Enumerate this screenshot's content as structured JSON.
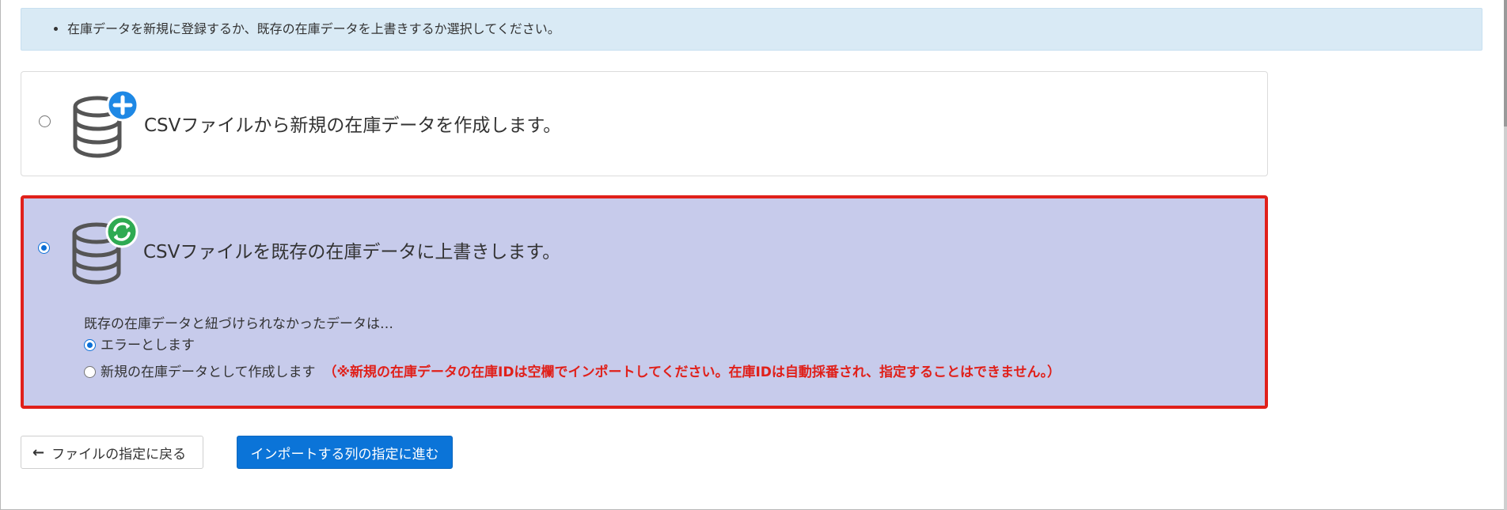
{
  "info": {
    "message": "在庫データを新規に登録するか、既存の在庫データを上書きするか選択してください。"
  },
  "options": [
    {
      "title": "CSVファイルから新規の在庫データを作成します。",
      "icon": "database-plus-icon",
      "selected": false
    },
    {
      "title": "CSVファイルを既存の在庫データに上書きします。",
      "icon": "database-sync-icon",
      "selected": true,
      "sub_question": "既存の在庫データと紐づけられなかったデータは…",
      "sub_options": [
        {
          "label": "エラーとします",
          "selected": true
        },
        {
          "label": "新規の在庫データとして作成します",
          "note": "（※新規の在庫データの在庫IDは空欄でインポートしてください。在庫IDは自動採番され、指定することはできません。）",
          "selected": false
        }
      ]
    }
  ],
  "buttons": {
    "back": "ファイルの指定に戻る",
    "next": "インポートする列の指定に進む"
  },
  "colors": {
    "accent": "#0b74d8",
    "highlight_border": "#e0201a",
    "highlight_bg": "#c7cbeb",
    "plus_badge": "#1e88e5",
    "sync_badge": "#2eaa52"
  }
}
